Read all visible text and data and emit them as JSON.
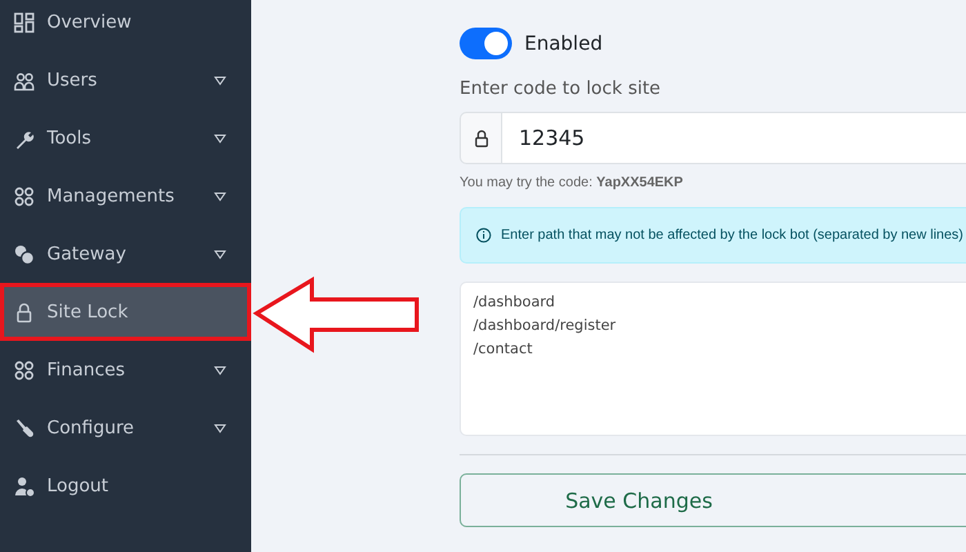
{
  "sidebar": {
    "items": [
      {
        "label": "Overview",
        "expandable": false,
        "selected": false,
        "highlighted": false
      },
      {
        "label": "Users",
        "expandable": true,
        "selected": false,
        "highlighted": false
      },
      {
        "label": "Tools",
        "expandable": true,
        "selected": false,
        "highlighted": false
      },
      {
        "label": "Managements",
        "expandable": true,
        "selected": false,
        "highlighted": false
      },
      {
        "label": "Gateway",
        "expandable": true,
        "selected": false,
        "highlighted": false
      },
      {
        "label": "Site Lock",
        "expandable": false,
        "selected": true,
        "highlighted": true
      },
      {
        "label": "Finances",
        "expandable": true,
        "selected": false,
        "highlighted": false
      },
      {
        "label": "Configure",
        "expandable": true,
        "selected": false,
        "highlighted": false
      },
      {
        "label": "Logout",
        "expandable": false,
        "selected": false,
        "highlighted": false
      }
    ]
  },
  "form": {
    "toggle": {
      "label": "Enabled",
      "on": true
    },
    "code_label": "Enter code to lock site",
    "code_value": "12345",
    "hint": "You may try the code: **YapXX54EKP**",
    "info": "Enter path that may not be affected by the lock bot (separated by new lines)",
    "paths": "/dashboard\n/dashboard/register\n/contact",
    "save_button": "Save Changes"
  }
}
